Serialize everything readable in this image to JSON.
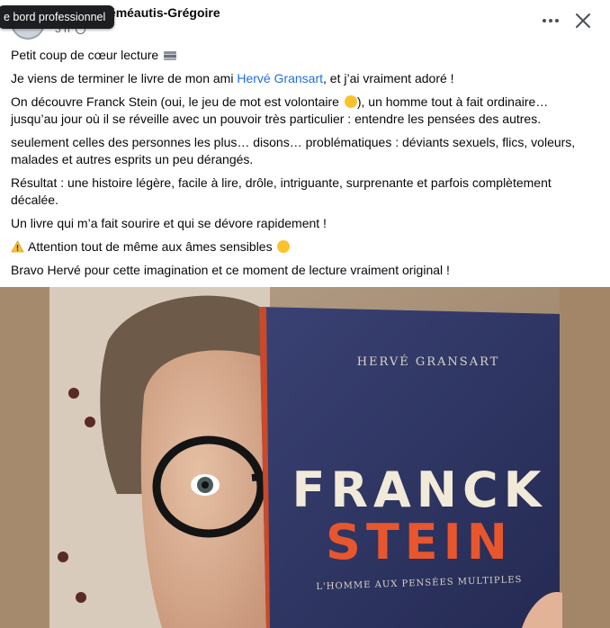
{
  "post": {
    "author": "Amélie Déméautis-Grégoire",
    "time": "3 h",
    "tooltip": "e bord professionnel"
  },
  "icons": {
    "more": "more-options-icon",
    "close": "close-icon",
    "privacy": "globe-icon",
    "book_emoji": "books-emoji",
    "wink_emoji": "wink-emoji",
    "warning_emoji": "warning-emoji"
  },
  "content": {
    "line1": "Petit coup de cœur lecture",
    "line2_pre": "Je viens de terminer le livre de mon ami ",
    "line2_link": "Hervé Gransart",
    "line2_post": ", et j’ai vraiment adoré !",
    "line3_pre": "On découvre Franck Stein (oui, le jeu de mot est volontaire ",
    "line3_post": "), un homme tout à fait ordinaire… jusqu’au jour où il se réveille avec un pouvoir très particulier : entendre les pensées des autres.",
    "line4": "seulement celles des personnes les plus… disons… problématiques : déviants sexuels, flics, voleurs, malades et autres esprits un peu dérangés.",
    "line5": "Résultat : une histoire légère, facile à lire, drôle, intriguante, surprenante et parfois complètement décalée.",
    "line6": "Un livre qui m’a fait sourire et qui se dévore rapidement !",
    "line7": "Attention tout de même aux âmes sensibles",
    "line8": "Bravo Hervé pour cette imagination et ce moment de lecture vraiment original !"
  },
  "book": {
    "author": "HERVÉ GRANSART",
    "title_line1": "FRANCK",
    "title_line2": "STEIN",
    "subtitle": "L'HOMME AUX PENSÉES MULTIPLES"
  },
  "colors": {
    "link": "#216fdb",
    "book_cover": "#2e3561",
    "book_title_orange": "#e8562e",
    "book_title_cream": "#f1ead9",
    "tooltip_bg": "#1c1e21"
  }
}
